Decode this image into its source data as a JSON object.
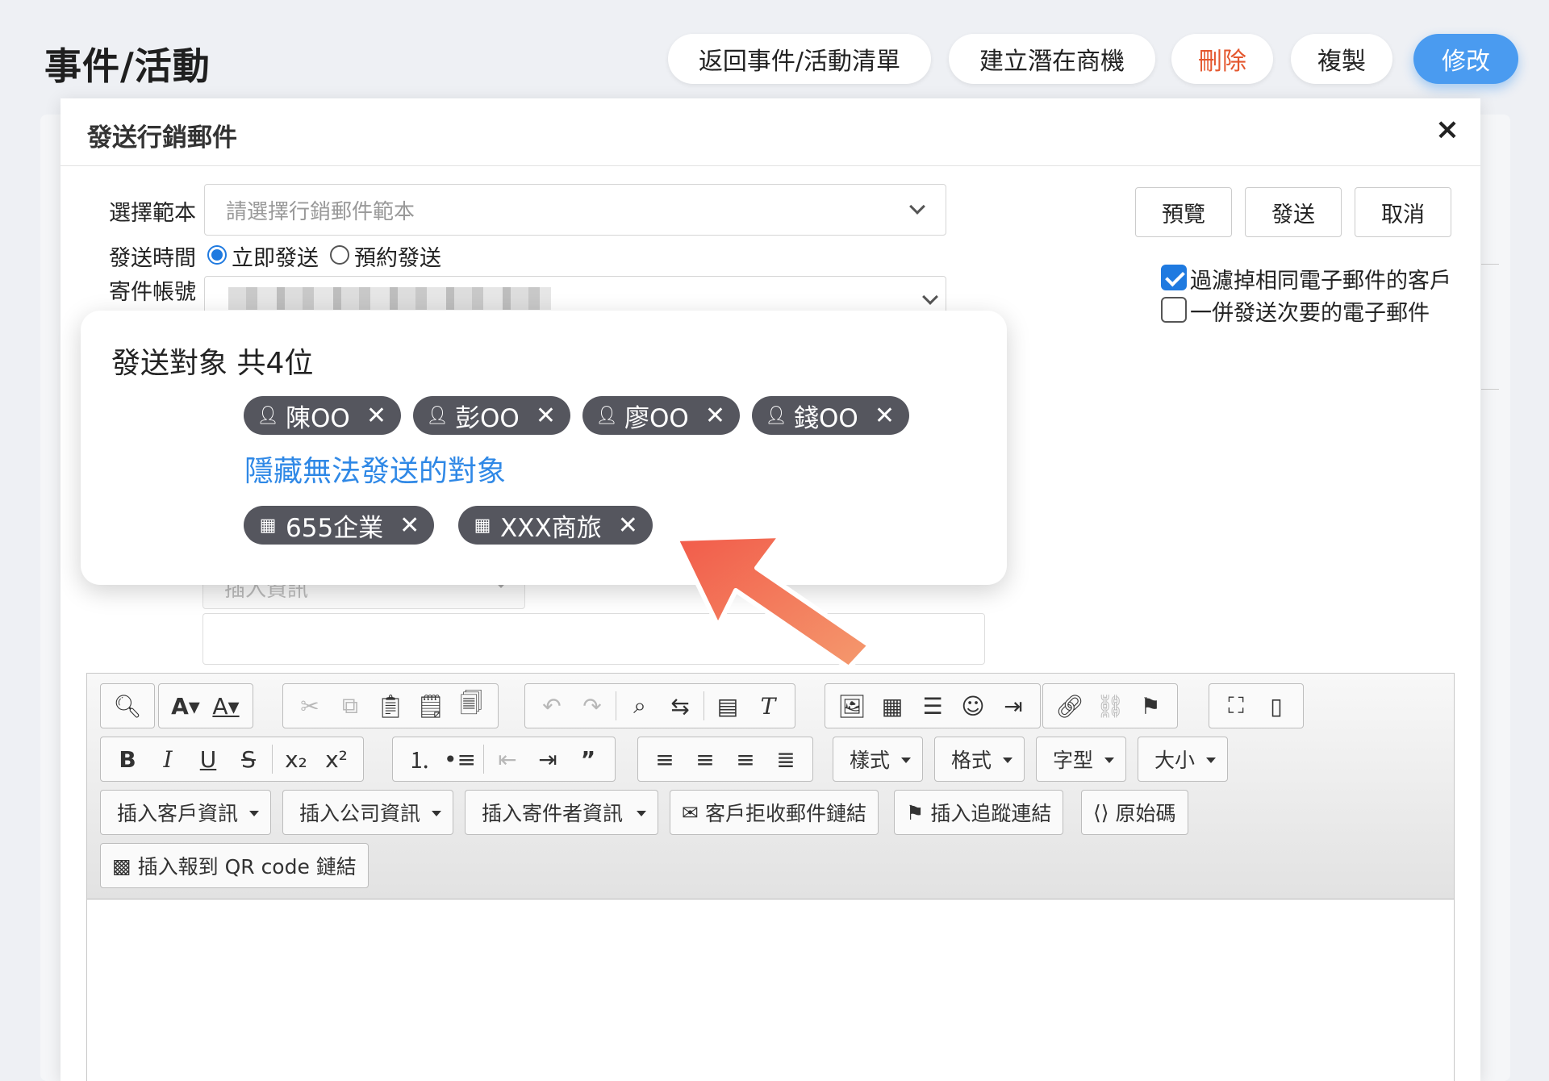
{
  "page": {
    "title": "事件/活動",
    "buttons": {
      "back": "返回事件/活動清單",
      "create_lead": "建立潛在商機",
      "delete": "刪除",
      "copy": "複製",
      "edit": "修改"
    }
  },
  "modal": {
    "title": "發送行銷郵件",
    "close": "×",
    "template_label": "選擇範本",
    "template_placeholder": "請選擇行銷郵件範本",
    "send_time_label": "發送時間",
    "send_now": "立即發送",
    "send_scheduled": "預約發送",
    "sender_label": "寄件帳號",
    "actions": {
      "preview": "預覽",
      "send": "發送",
      "cancel": "取消"
    },
    "options": {
      "filter_duplicates": "過濾掉相同電子郵件的客戶",
      "filter_duplicates_checked": true,
      "send_secondary": "一併發送次要的電子郵件",
      "send_secondary_checked": false
    },
    "insert_info_placeholder": "插入資訊"
  },
  "recipients_popup": {
    "title": "發送對象 共4位",
    "people": [
      {
        "name": "陳OO"
      },
      {
        "name": "彭OO"
      },
      {
        "name": "廖OO"
      },
      {
        "name": "錢OO"
      }
    ],
    "hide_link": "隱藏無法發送的對象",
    "companies": [
      {
        "name": "655企業"
      },
      {
        "name": "XXX商旅"
      }
    ]
  },
  "editor": {
    "combos": {
      "style": "樣式",
      "format": "格式",
      "font": "字型",
      "size": "大小"
    },
    "insert_buttons": {
      "customer_info": "插入客戶資訊",
      "company_info": "插入公司資訊",
      "sender_info": "插入寄件者資訊",
      "unsubscribe_link": "客戶拒收郵件鏈結",
      "tracking_link": "插入追蹤連結",
      "source": "原始碼",
      "qr_link": "插入報到 QR code 鏈結"
    }
  },
  "colors": {
    "primary": "#4a9bf0",
    "danger": "#e4572e",
    "link": "#2f88e6",
    "chip": "#55565e",
    "arrow": "#f0705a"
  }
}
